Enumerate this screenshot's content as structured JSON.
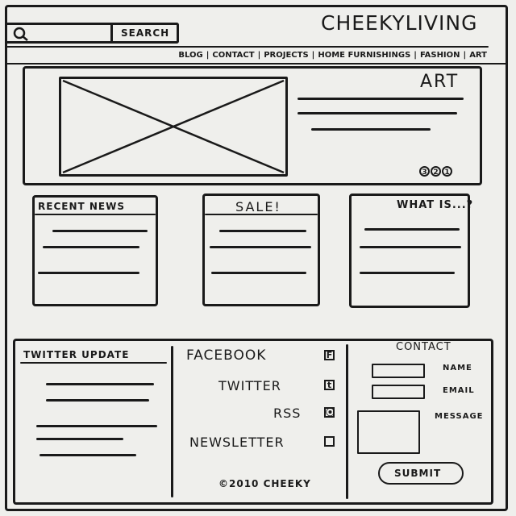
{
  "header": {
    "logo": "CHEEKYLIVING",
    "search_button": "SEARCH"
  },
  "nav": {
    "items": [
      "ART",
      "FASHION",
      "HOME FURNISHINGS",
      "PROJECTS",
      "CONTACT",
      "BLOG"
    ]
  },
  "hero": {
    "title": "ART",
    "pages": [
      "1",
      "2",
      "3"
    ]
  },
  "panels": {
    "recent_news": "RECENT NEWS",
    "sale": "SALE!",
    "what_is": "WHAT IS...?"
  },
  "twitter": {
    "title": "TWITTER UPDATE"
  },
  "social": {
    "items": [
      {
        "label": "FACEBOOK",
        "mark": "F"
      },
      {
        "label": "TWITTER",
        "mark": "t"
      },
      {
        "label": "RSS",
        "mark": "⦿"
      },
      {
        "label": "NEWSLETTER",
        "mark": ""
      }
    ],
    "copyright": "©2010 CHEEKY"
  },
  "contact": {
    "title": "CONTACT",
    "name_label": "NAME",
    "email_label": "EMAIL",
    "message_label": "MESSAGE",
    "submit": "SUBMIT"
  }
}
